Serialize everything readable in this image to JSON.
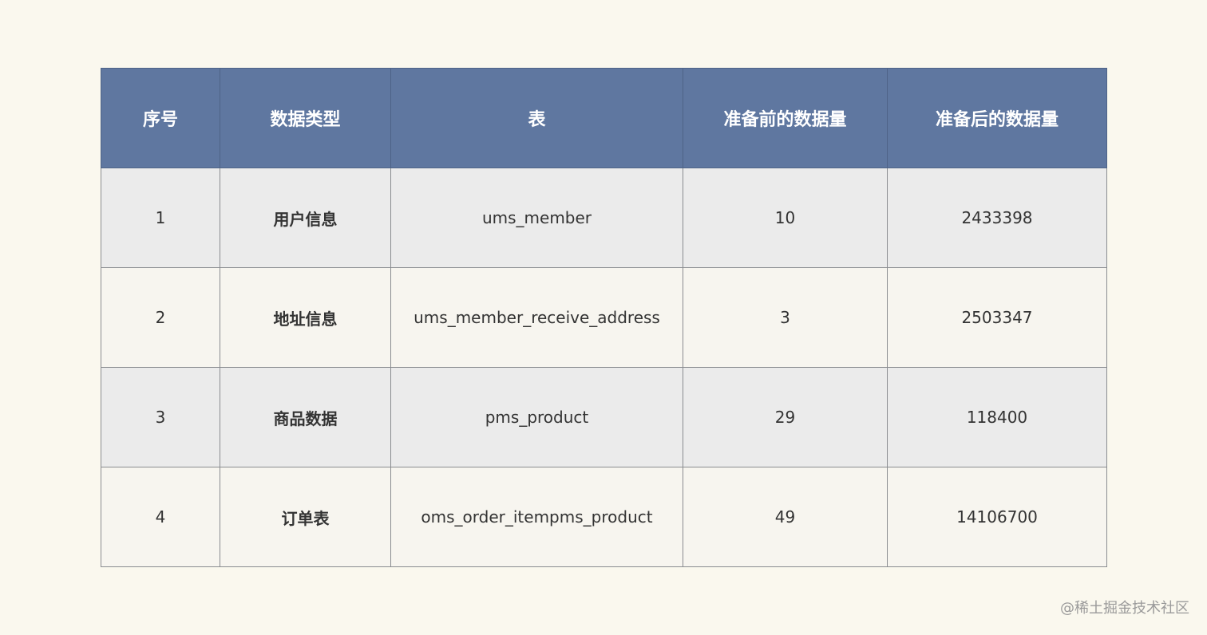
{
  "table": {
    "headers": [
      "序号",
      "数据类型",
      "表",
      "准备前的数据量",
      "准备后的数据量"
    ],
    "rows": [
      [
        "1",
        "用户信息",
        "ums_member",
        "10",
        "2433398"
      ],
      [
        "2",
        "地址信息",
        "ums_member_receive_address",
        "3",
        "2503347"
      ],
      [
        "3",
        "商品数据",
        "pms_product",
        "29",
        "118400"
      ],
      [
        "4",
        "订单表",
        "oms_order_itempms_product",
        "49",
        "14106700"
      ]
    ]
  },
  "watermark": "@稀土掘金技术社区",
  "colors": {
    "background": "#faf8ee",
    "header": "#5f77a0",
    "row_odd": "#ebebeb",
    "row_even": "#f7f5ef"
  }
}
